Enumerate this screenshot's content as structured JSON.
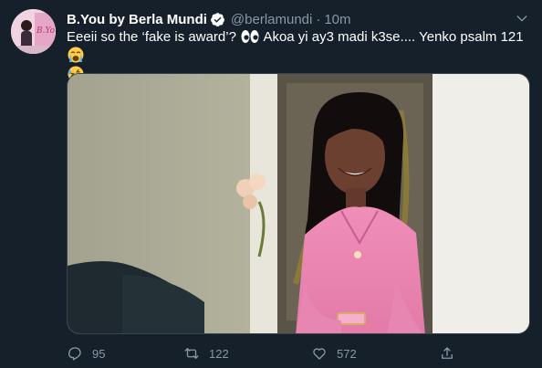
{
  "tweet": {
    "author_name": "B.You by Berla Mundi",
    "handle": "@berlamundi",
    "separator": "·",
    "time": "10m",
    "text_part1": "Eeeii so the ‘fake is award’?",
    "text_part2": "Akoa yi ay3 madi k3se.... Yenko psalm 121"
  },
  "actions": {
    "reply_count": "95",
    "retweet_count": "122",
    "like_count": "572"
  },
  "icons": {
    "verified": "verified-badge-icon",
    "caret": "chevron-down-icon",
    "reply": "reply-icon",
    "retweet": "retweet-icon",
    "like": "heart-icon",
    "share": "share-icon"
  },
  "colors": {
    "background": "#15202b",
    "secondary_text": "#8899a6",
    "verified_blue": "#1da1f2"
  }
}
